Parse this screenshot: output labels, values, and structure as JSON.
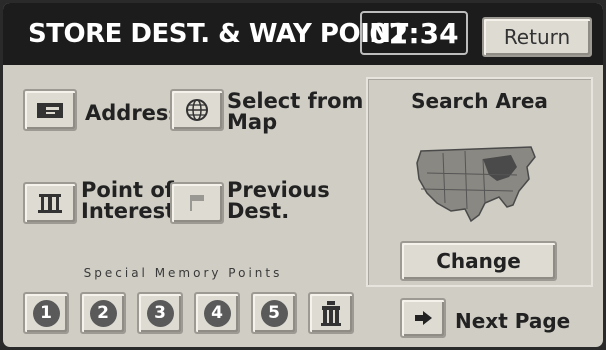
{
  "header": {
    "title": "STORE DEST. & WAY POINT",
    "clock": "02:34",
    "return_label": "Return"
  },
  "methods": [
    {
      "label": "Address",
      "icon": "address-card-icon"
    },
    {
      "label": "Select from\nMap",
      "icon": "globe-grid-icon"
    },
    {
      "label": "Point of\nInterest",
      "icon": "building-icon"
    },
    {
      "label": "Previous\nDest.",
      "icon": "flag-icon"
    }
  ],
  "search_area": {
    "title": "Search Area",
    "change_label": "Change",
    "map_icon": "us-map-icon"
  },
  "memory": {
    "title": "Special Memory Points",
    "points": [
      "1",
      "2",
      "3",
      "4",
      "5"
    ],
    "home_icon": "home-icon"
  },
  "footer": {
    "next_label": "Next Page",
    "next_icon": "arrow-right-icon"
  },
  "colors": {
    "header": "#1c1c1c",
    "panel": "#cfcdc4",
    "button": "#dedbd3",
    "memory_badge": "#5a5a5a"
  }
}
